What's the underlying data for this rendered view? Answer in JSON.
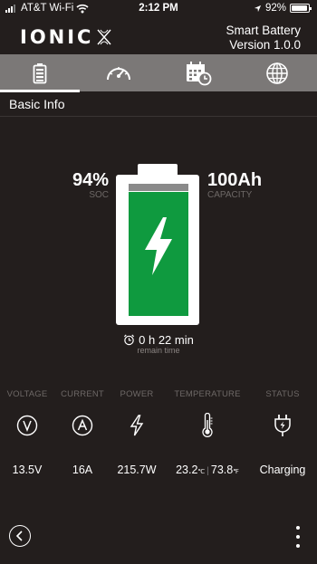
{
  "status_bar": {
    "carrier": "AT&T Wi-Fi",
    "time": "2:12 PM",
    "battery_percent": "92%",
    "icons": [
      "signal-icon",
      "wifi-icon",
      "location-icon",
      "battery-icon"
    ]
  },
  "header": {
    "logo_text": "IONIC",
    "app_name": "Smart Battery",
    "version": "Version 1.0.0"
  },
  "tabs": [
    {
      "icon": "battery-icon",
      "active": true
    },
    {
      "icon": "speedometer-icon",
      "active": false
    },
    {
      "icon": "calendar-clock-icon",
      "active": false
    },
    {
      "icon": "globe-icon",
      "active": false
    }
  ],
  "section_title": "Basic Info",
  "battery": {
    "soc_value": "94%",
    "soc_label": "SOC",
    "capacity_value": "100Ah",
    "capacity_label": "CAPACITY",
    "fill_fraction": 0.94,
    "remain_time": "0 h 22 min",
    "remain_label": "remain time",
    "fill_color": "#0f9a3f"
  },
  "metrics": {
    "voltage": {
      "label": "VOLTAGE",
      "value": "13.5V",
      "icon": "voltage-icon"
    },
    "current": {
      "label": "CURRENT",
      "value": "16A",
      "icon": "current-icon"
    },
    "power": {
      "label": "POWER",
      "value": "215.7W",
      "icon": "lightning-icon"
    },
    "temperature": {
      "label": "TEMPERATURE",
      "celsius": "23.2",
      "celsius_unit": "℃",
      "separator": "|",
      "fahrenheit": "73.8",
      "fahrenheit_unit": "℉",
      "icon": "thermometer-icon"
    },
    "status": {
      "label": "STATUS",
      "value": "Charging",
      "icon": "plug-charging-icon"
    }
  },
  "colors": {
    "background": "#231e1d",
    "tab_bar": "#7b7877",
    "muted_label": "#6d6866"
  }
}
